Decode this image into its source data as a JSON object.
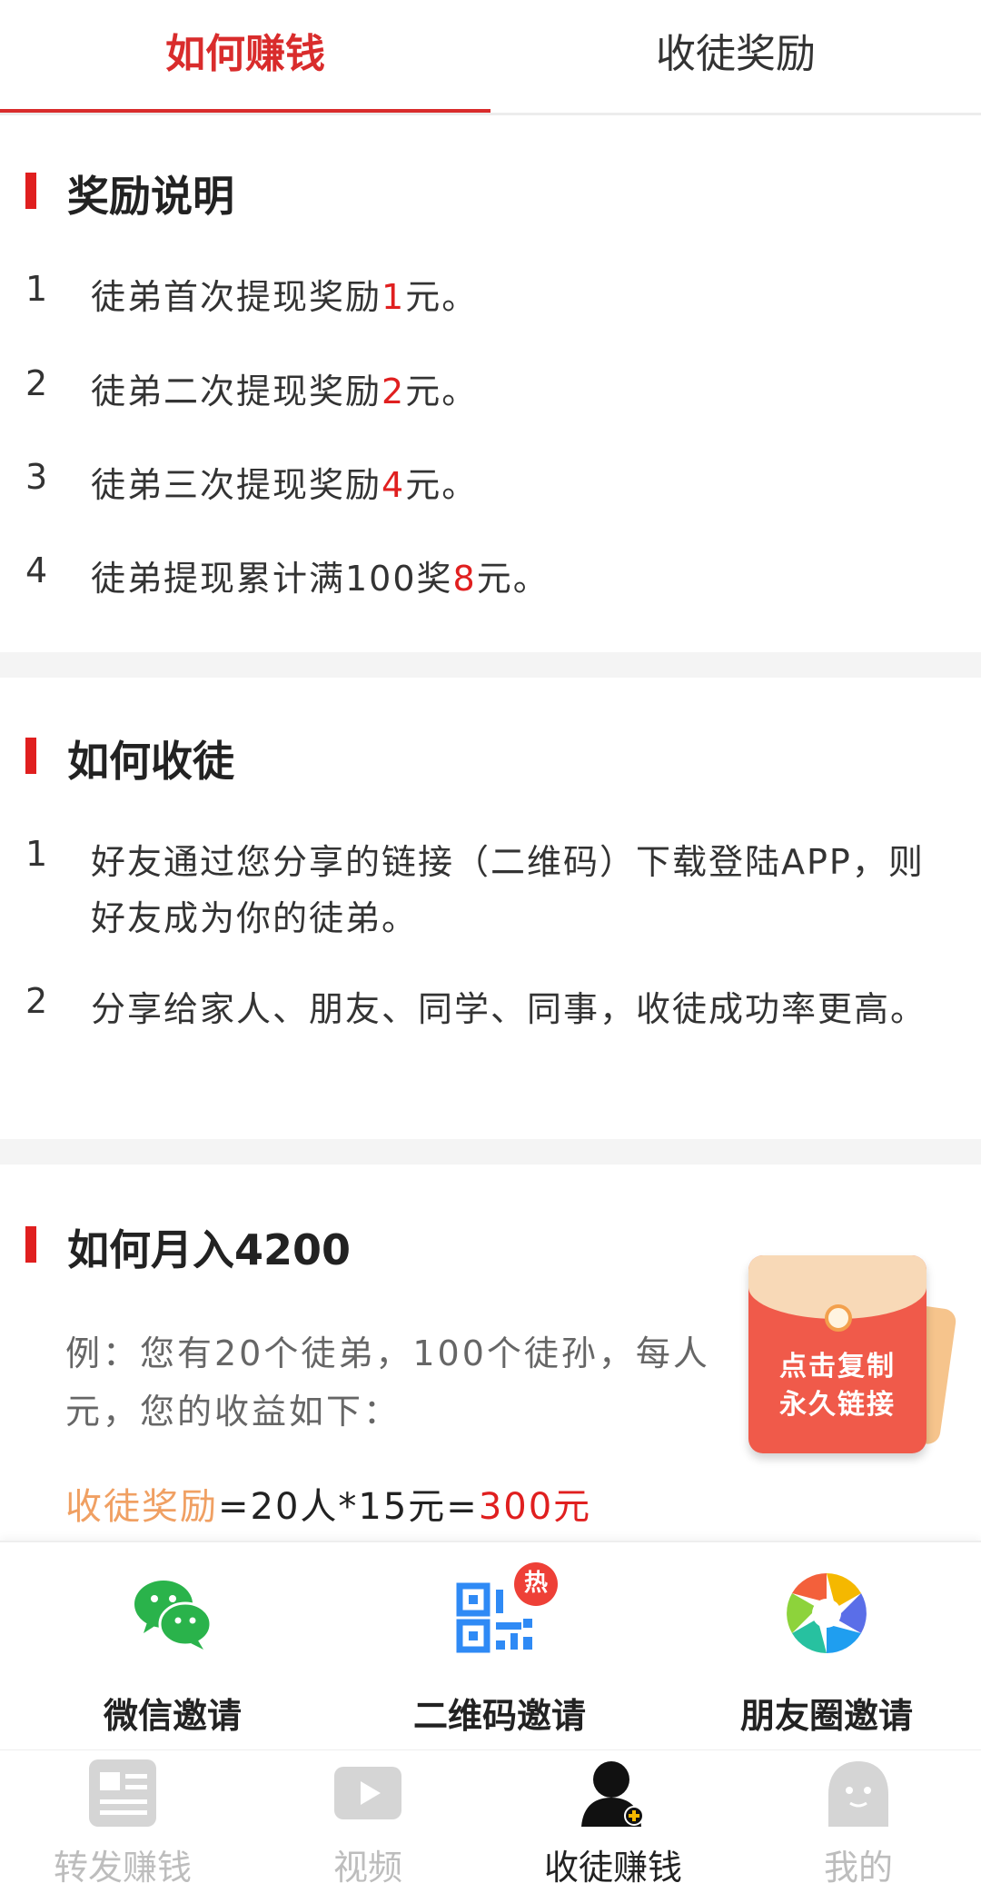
{
  "tabs": [
    {
      "label": "如何赚钱",
      "active": true
    },
    {
      "label": "收徒奖励",
      "active": false
    }
  ],
  "reward": {
    "title": "奖励说明",
    "items": [
      {
        "num": "1",
        "pre": "徒弟首次提现奖励",
        "val": "1",
        "post": "元。"
      },
      {
        "num": "2",
        "pre": "徒弟二次提现奖励",
        "val": "2",
        "post": "元。"
      },
      {
        "num": "3",
        "pre": "徒弟三次提现奖励",
        "val": "4",
        "post": "元。"
      },
      {
        "num": "4",
        "pre": "徒弟提现累计满100奖",
        "val": "8",
        "post": "元。"
      }
    ]
  },
  "howto": {
    "title": "如何收徒",
    "items": [
      {
        "num": "1",
        "text": "好友通过您分享的链接（二维码）下载登陆APP，则好友成为你的徒弟。"
      },
      {
        "num": "2",
        "text": "分享给家人、朋友、同学、同事，收徒成功率更高。"
      }
    ]
  },
  "monthly": {
    "title": "如何月入4200",
    "example_line1": "例：您有20个徒弟，100个徒孙，每人",
    "example_line2": "元，您的收益如下：",
    "calc_label": "收徒奖励",
    "calc_expr": "=20人*15元=",
    "calc_result": "300元"
  },
  "envelope": {
    "line1": "点击复制",
    "line2": "永久链接"
  },
  "invite": {
    "items": [
      {
        "label": "微信邀请",
        "icon": "wechat-icon"
      },
      {
        "label": "二维码邀请",
        "icon": "qrcode-icon",
        "badge": "热"
      },
      {
        "label": "朋友圈邀请",
        "icon": "moments-icon"
      }
    ]
  },
  "nav": {
    "items": [
      {
        "label": "转发赚钱",
        "icon": "news-icon",
        "active": false
      },
      {
        "label": "视频",
        "icon": "video-icon",
        "active": false
      },
      {
        "label": "收徒赚钱",
        "icon": "user-add-icon",
        "active": true
      },
      {
        "label": "我的",
        "icon": "profile-icon",
        "active": false
      }
    ]
  },
  "colors": {
    "accent": "#e01f1f",
    "orange": "#f0a063",
    "inactive": "#bdbdbd"
  }
}
